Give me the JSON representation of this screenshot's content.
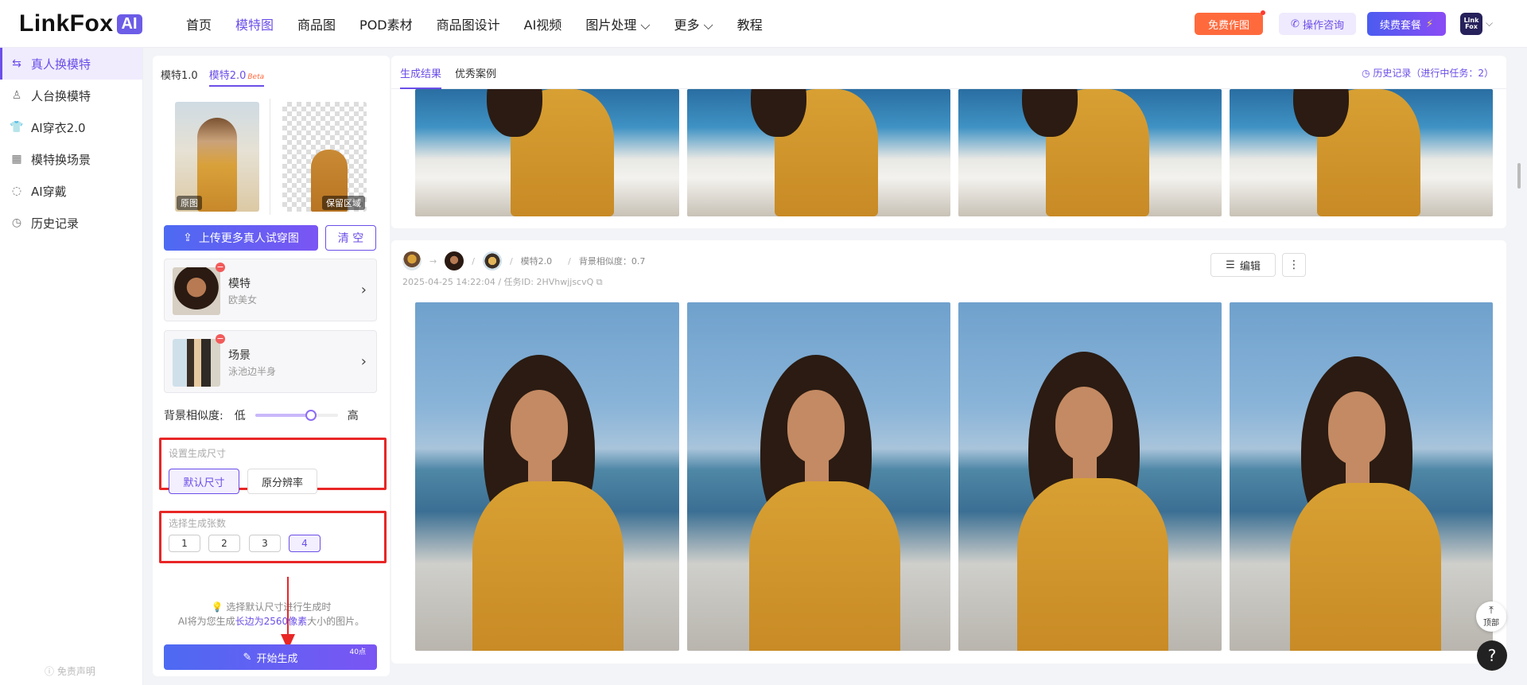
{
  "brand": {
    "name": "LinkFox",
    "badge": "AI"
  },
  "nav": [
    "首页",
    "模特图",
    "商品图",
    "POD素材",
    "商品图设计",
    "AI视频",
    "图片处理 ⌵",
    "更多 ⌵",
    "教程"
  ],
  "topbar": {
    "free_btn": "免费作图",
    "consult_btn": "操作咨询",
    "renew_btn": "续费套餐",
    "avatar": "Link Fox"
  },
  "sidebar": {
    "items": [
      "真人换模特",
      "人台换模特",
      "AI穿衣2.0",
      "模特换场景",
      "AI穿戴",
      "历史记录"
    ],
    "disclaimer": "免责声明"
  },
  "panel": {
    "tab1": "模特1.0",
    "tab2": "模特2.0",
    "beta": "Beta",
    "orig_label": "原图",
    "keep_label": "保留区域",
    "upload_btn": "上传更多真人试穿图",
    "clear_btn": "清 空",
    "model": {
      "title": "模特",
      "sub": "欧美女"
    },
    "scene": {
      "title": "场景",
      "sub": "泳池边半身"
    },
    "similarity": {
      "label": "背景相似度:",
      "low": "低",
      "high": "高",
      "value": 0.7
    },
    "size": {
      "title": "设置生成尺寸",
      "default": "默认尺寸",
      "orig": "原分辨率"
    },
    "count": {
      "title": "选择生成张数",
      "options": [
        "1",
        "2",
        "3",
        "4"
      ],
      "selected": "4"
    },
    "tip": {
      "line1": "💡 选择默认尺寸进行生成时",
      "line2a": "AI将为您生成",
      "line2b": "长边为2560像素",
      "line2c": "大小的图片。"
    },
    "generate_btn": "开始生成",
    "cost": "40点"
  },
  "results": {
    "tab_results": "生成结果",
    "tab_cases": "优秀案例",
    "history": "历史记录（进行中任务：2）",
    "task": {
      "model_version": "模特2.0",
      "similarity": "背景相似度：0.7",
      "date_id": "2025-04-25 14:22:04 / 任务ID: 2HVhwjjscvQ",
      "edit_btn": "编辑",
      "more_btn": "⋮"
    }
  },
  "floating": {
    "top": "顶部",
    "help": "?"
  }
}
